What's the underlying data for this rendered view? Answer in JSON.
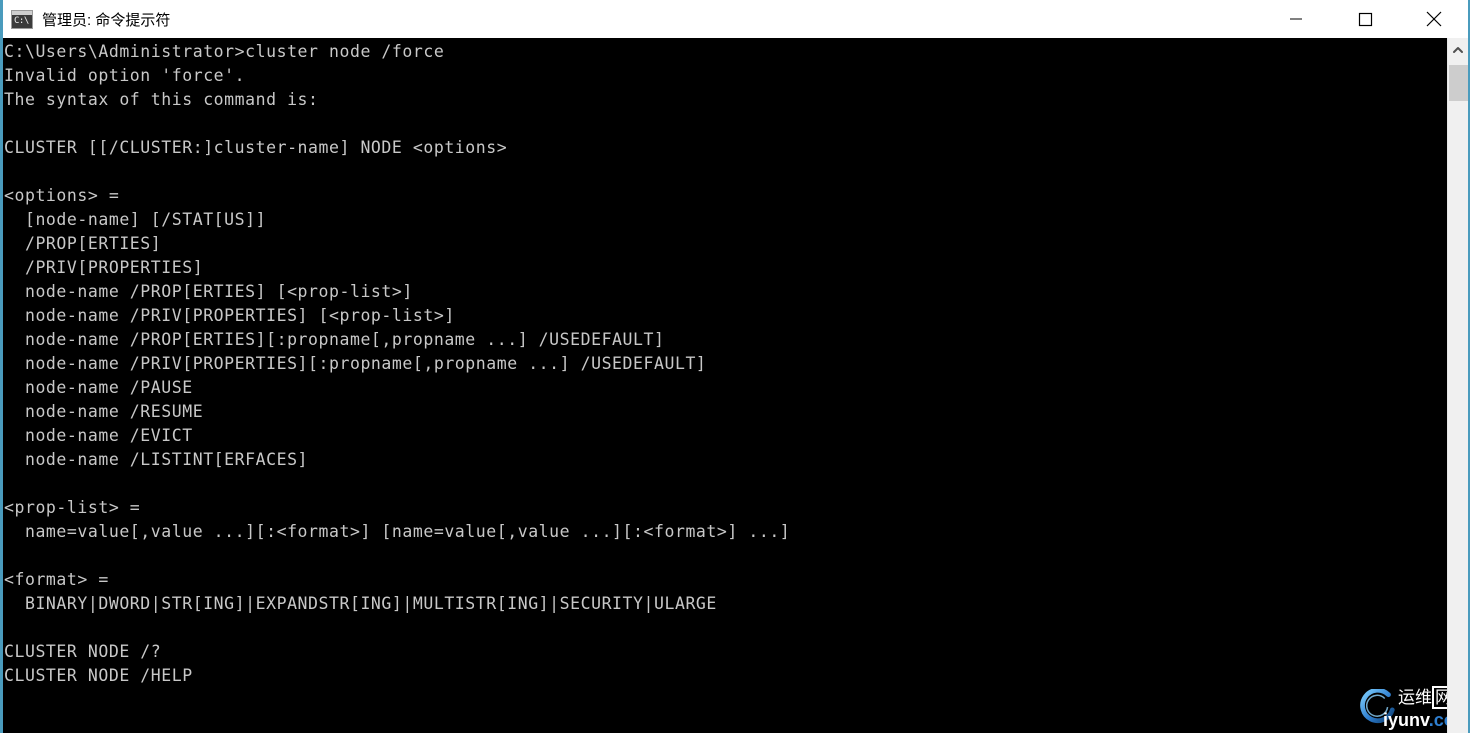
{
  "window": {
    "title": "管理员: 命令提示符",
    "icon": "cmd-icon",
    "icon_glyph": "C:\\",
    "controls": {
      "minimize": "minimize-icon",
      "maximize": "maximize-icon",
      "close": "close-icon"
    }
  },
  "terminal": {
    "prompt_path": "C:\\Users\\Administrator>",
    "command": "cluster node /force",
    "lines": [
      "C:\\Users\\Administrator>cluster node /force",
      "Invalid option 'force'.",
      "The syntax of this command is:",
      "",
      "CLUSTER [[/CLUSTER:]cluster-name] NODE <options>",
      "",
      "<options> =",
      "  [node-name] [/STAT[US]]",
      "  /PROP[ERTIES]",
      "  /PRIV[PROPERTIES]",
      "  node-name /PROP[ERTIES] [<prop-list>]",
      "  node-name /PRIV[PROPERTIES] [<prop-list>]",
      "  node-name /PROP[ERTIES][:propname[,propname ...] /USEDEFAULT]",
      "  node-name /PRIV[PROPERTIES][:propname[,propname ...] /USEDEFAULT]",
      "  node-name /PAUSE",
      "  node-name /RESUME",
      "  node-name /EVICT",
      "  node-name /LISTINT[ERFACES]",
      "",
      "<prop-list> =",
      "  name=value[,value ...][:<format>] [name=value[,value ...][:<format>] ...]",
      "",
      "<format> =",
      "  BINARY|DWORD|STR[ING]|EXPANDSTR[ING]|MULTISTR[ING]|SECURITY|ULARGE",
      "",
      "CLUSTER NODE /?",
      "CLUSTER NODE /HELP"
    ],
    "colors": {
      "background": "#000000",
      "foreground": "#c8c8c8",
      "window_border": "#4a9bbd"
    }
  },
  "scrollbar": {
    "up_arrow": "chevron-up-icon"
  },
  "watermark": {
    "cn_text_main": "运维",
    "cn_text_boxed": "网",
    "url_prefix": "iyunv",
    "url_suffix": ".com",
    "ring_color": "#2f7fd0"
  }
}
